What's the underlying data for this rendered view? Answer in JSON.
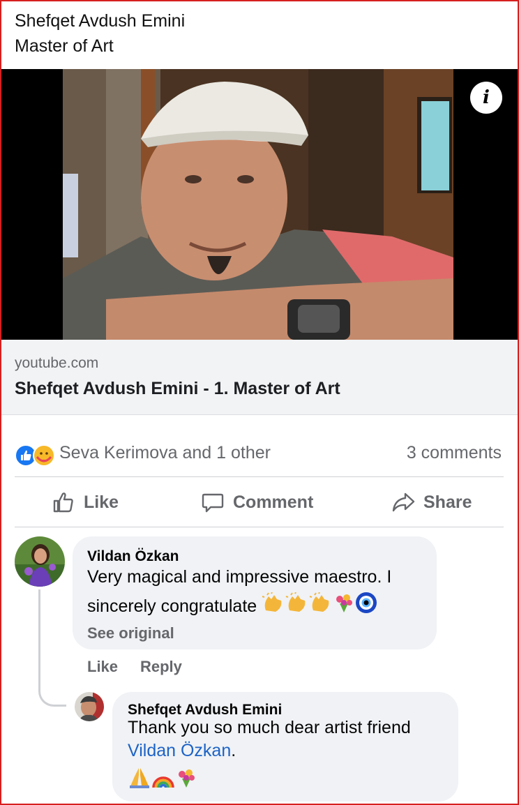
{
  "post": {
    "text_line1": "Shefqet Avdush Emini",
    "text_line2": "Master of Art"
  },
  "media": {
    "info_icon": "info-icon",
    "info_glyph": "i"
  },
  "link_preview": {
    "domain": "youtube.com",
    "title": "Shefqet Avdush Emini - 1. Master of Art"
  },
  "reactions": {
    "icons": [
      "like-reaction-icon",
      "care-reaction-icon"
    ],
    "summary": "Seva  Kerimova and 1 other",
    "comments": "3 comments"
  },
  "actions": {
    "like": "Like",
    "comment": "Comment",
    "share": "Share"
  },
  "comments": [
    {
      "author": "Vildan Özkan",
      "text_line1": "Very magical and impressive maestro. I",
      "text_line2": "sincerely congratulate",
      "emojis": [
        "clapping-hands",
        "clapping-hands",
        "clapping-hands",
        "bouquet",
        "nazar-amulet"
      ],
      "see_original": "See original",
      "like": "Like",
      "reply": "Reply"
    },
    {
      "author": "Shefqet Avdush Emini",
      "text_line1": "Thank you so much dear artist friend",
      "mention": "Vildan Özkan",
      "after_mention": ".",
      "emojis": [
        "folded-hands",
        "rainbow",
        "bouquet"
      ]
    }
  ],
  "colors": {
    "frame": "#d61f1f",
    "like_blue": "#1877f2",
    "care_yellow": "#f7b928",
    "mention": "#1d63c6",
    "muted_text": "#65676b",
    "bubble": "#f0f2f5"
  }
}
